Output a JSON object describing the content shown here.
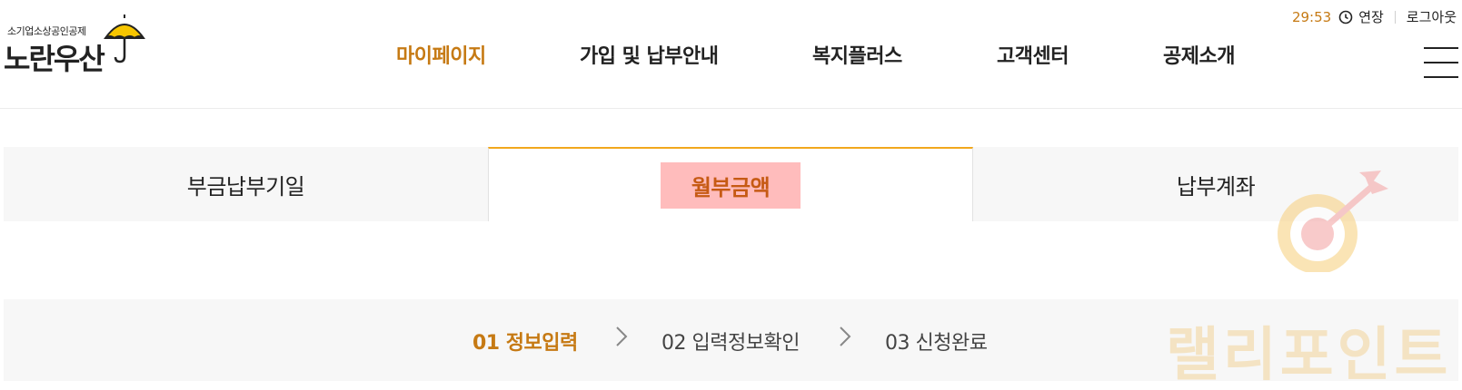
{
  "logo": {
    "subtitle": "소기업소상공인공제",
    "title": "노란우산"
  },
  "nav": {
    "items": [
      {
        "label": "마이페이지",
        "active": true
      },
      {
        "label": "가입 및 납부안내",
        "active": false
      },
      {
        "label": "복지플러스",
        "active": false
      },
      {
        "label": "고객센터",
        "active": false
      },
      {
        "label": "공제소개",
        "active": false
      }
    ]
  },
  "session": {
    "timer": "29:53",
    "extend_label": "연장",
    "logout_label": "로그아웃"
  },
  "tabs": [
    {
      "label": "부금납부기일",
      "active": false
    },
    {
      "label": "월부금액",
      "active": true
    },
    {
      "label": "납부계좌",
      "active": false
    }
  ],
  "steps": [
    {
      "label": "01 정보입력",
      "active": true
    },
    {
      "label": "02 입력정보확인",
      "active": false
    },
    {
      "label": "03 신청완료",
      "active": false
    }
  ],
  "watermark": {
    "text": "랠리포인트"
  },
  "colors": {
    "accent": "#c67a14",
    "tab_border": "#f2a81d",
    "tab_highlight": "#ffbcbc",
    "umbrella": "#f7c600"
  },
  "icons": {
    "clock": "clock-icon",
    "menu": "hamburger-menu-icon",
    "chevron": "chevron-right-icon",
    "umbrella": "umbrella-logo-icon",
    "target": "target-arrow-icon"
  }
}
